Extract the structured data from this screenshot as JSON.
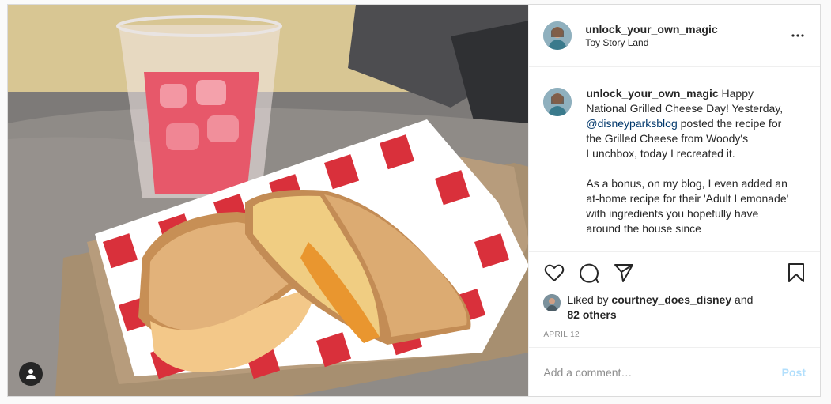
{
  "post": {
    "user": {
      "username": "unlock_your_own_magic",
      "location": "Toy Story Land",
      "avatar_icon": "profile-photo"
    },
    "photo": {
      "alt_subject": "grilled-cheese-and-lemonade",
      "tag_icon": "user-tag-icon"
    },
    "caption": {
      "username": "unlock_your_own_magic",
      "line1": "Happy National Grilled Cheese Day! Yesterday,",
      "mention": "@disneyparksblog",
      "line1_end": "posted the recipe for the Grilled Cheese from Woody's Lunchbox, today I recreated it.",
      "para2": "As a bonus, on my blog, I even added an at-home recipe for their 'Adult Lemonade' with ingredients you hopefully have around the house since"
    },
    "actions": {
      "like_icon": "heart-icon",
      "comment_icon": "comment-icon",
      "share_icon": "share-icon",
      "save_icon": "bookmark-icon"
    },
    "likes": {
      "prefix": "Liked by",
      "liker": "courtney_does_disney",
      "and": "and",
      "others": "82 others"
    },
    "date": "APRIL 12",
    "comment": {
      "placeholder": "Add a comment…",
      "post_label": "Post"
    },
    "colors": {
      "link": "#00376b",
      "post_button": "#b2dffc",
      "meta_text": "#8e8e8e"
    }
  }
}
